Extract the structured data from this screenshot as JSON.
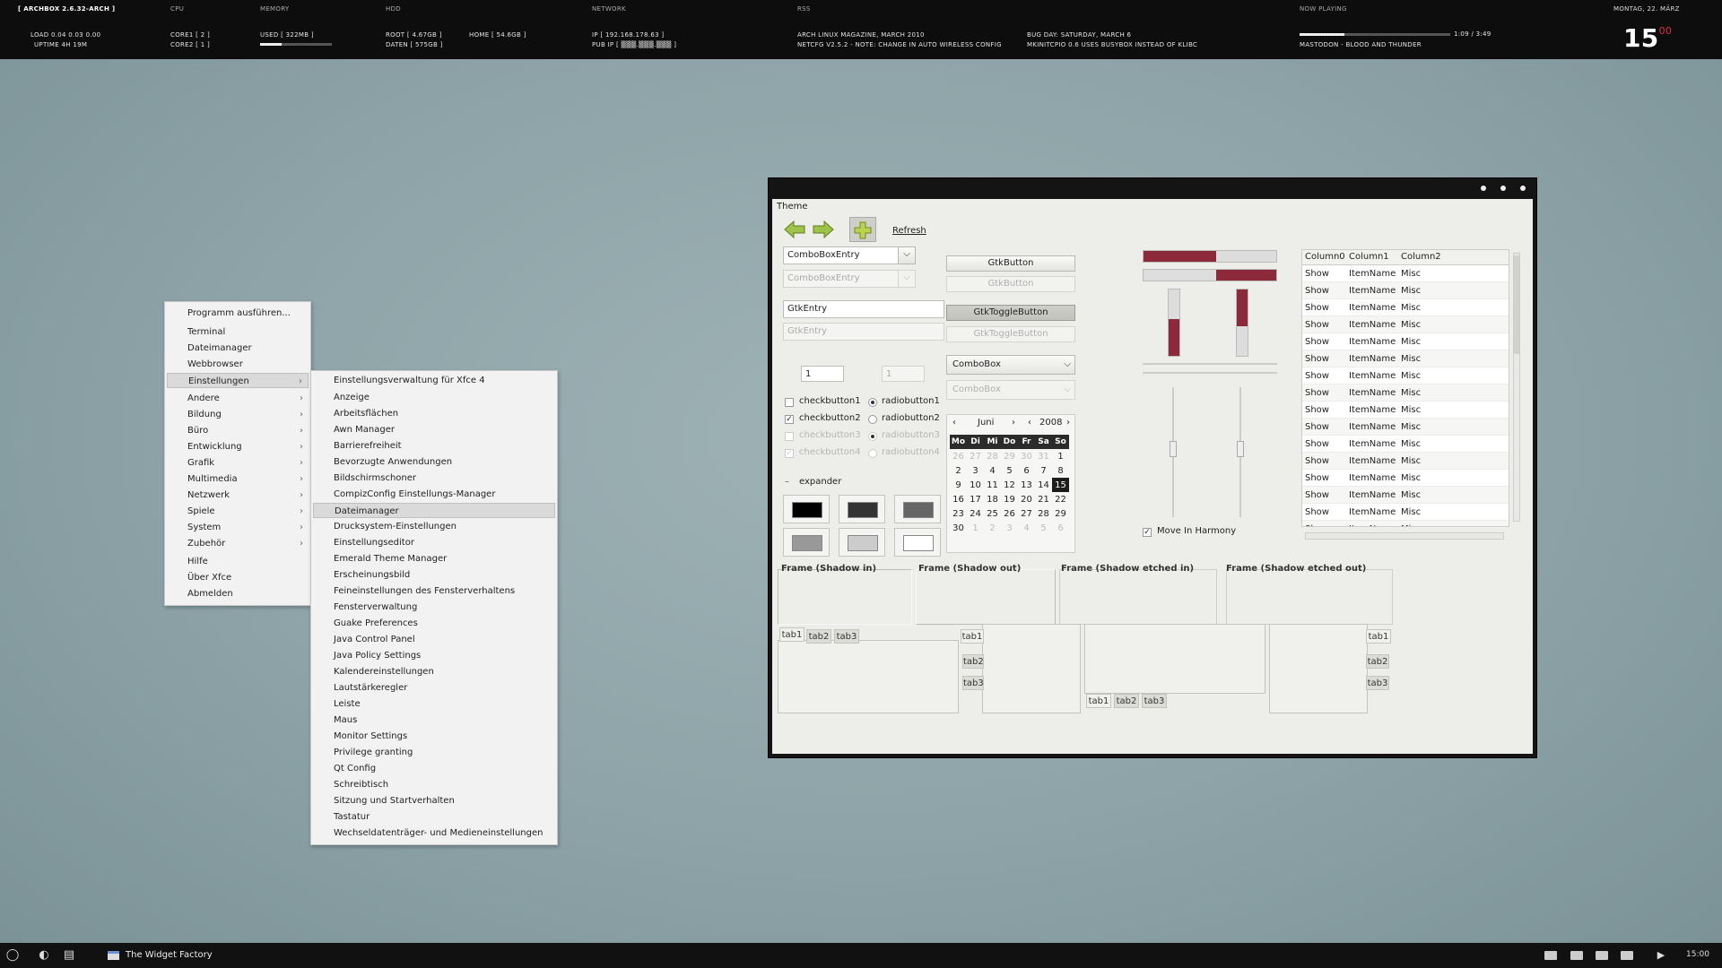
{
  "conky": {
    "distro": "[ ARCHBOX  2.6.32-ARCH ]",
    "load": "LOAD  0.04 0.03 0.00",
    "uptime": "UPTIME    4H 19M",
    "cpu_header": "CPU",
    "core1": "CORE1  [ 2 ]",
    "core2": "CORE2  [ 1 ]",
    "mem_header": "MEMORY",
    "mem_used": "USED  [ 322MB ]",
    "mem_fraction": 0.3,
    "hdd_header": "HDD",
    "hdd_root": "ROOT  [ 4.67GB ]",
    "hdd_daten": "DATEN  [ 575GB ]",
    "hdd_home": "HOME  [ 54.6GB ]",
    "net_header": "NETWORK",
    "ip": "IP      [ 192.168.178.63 ]",
    "pub_ip": "PUB IP  [ ▒▒▒.▒▒▒.▒▒▒ ]",
    "rss_header": "RSS",
    "rss1": "ARCH LINUX MAGAZINE, MARCH 2010",
    "rss2": "NETCFG V2.5.2 - NOTE: CHANGE IN AUTO WIRELESS CONFIG",
    "rss3": "BUG DAY: SATURDAY, MARCH 6",
    "rss4": "MKINITCPIO 0.6 USES BUSYBOX INSTEAD OF KLIBC",
    "np_header": "NOW PLAYING",
    "np_time": "1:09 / 3:49",
    "np_track": "MASTODON - BLOOD AND THUNDER",
    "np_fraction": 0.3,
    "date": "MONTAG, 22. MÄRZ",
    "clock_hour": "15",
    "clock_min": "00"
  },
  "taskbar": {
    "task": "The Widget Factory",
    "clock": "15:00"
  },
  "main_menu": [
    "Programm ausführen...",
    "Terminal",
    "Dateimanager",
    "Webbrowser",
    "Einstellungen",
    "Andere",
    "Bildung",
    "Büro",
    "Entwicklung",
    "Grafik",
    "Multimedia",
    "Netzwerk",
    "Spiele",
    "System",
    "Zubehör",
    "Hilfe",
    "Über Xfce",
    "Abmelden"
  ],
  "sub_menu": [
    "Einstellungsverwaltung für Xfce 4",
    "Anzeige",
    "Arbeitsflächen",
    "Awn Manager",
    "Barrierefreiheit",
    "Bevorzugte Anwendungen",
    "Bildschirmschoner",
    "CompizConfig Einstellungs-Manager",
    "Dateimanager",
    "Drucksystem-Einstellungen",
    "Einstellungseditor",
    "Emerald Theme Manager",
    "Erscheinungsbild",
    "Feineinstellungen des Fensterverhaltens",
    "Fensterverwaltung",
    "Guake Preferences",
    "Java Control Panel",
    "Java Policy Settings",
    "Kalendereinstellungen",
    "Lautstärkeregler",
    "Leiste",
    "Maus",
    "Monitor Settings",
    "Privilege granting",
    "Qt Config",
    "Schreibtisch",
    "Sitzung und Startverhalten",
    "Tastatur",
    "Wechseldatenträger- und Medieneinstellungen"
  ],
  "widget": {
    "menu_title": "Theme",
    "refresh": "Refresh",
    "combo_entry": "ComboBoxEntry",
    "gtk_entry": "GtkEntry",
    "spin": "1",
    "checks": [
      "checkbutton1",
      "checkbutton2",
      "checkbutton3",
      "checkbutton4"
    ],
    "radios": [
      "radiobutton1",
      "radiobutton2",
      "radiobutton3",
      "radiobutton4"
    ],
    "expander": "expander",
    "gtk_button": "GtkButton",
    "gtk_toggle": "GtkToggleButton",
    "combo": "ComboBox",
    "cal_month": "Juni",
    "cal_year": "2008",
    "cal_days": [
      "Mo",
      "Di",
      "Mi",
      "Do",
      "Fr",
      "Sa",
      "So"
    ],
    "cal_rows": [
      [
        "26",
        "27",
        "28",
        "29",
        "30",
        "31",
        "1"
      ],
      [
        "2",
        "3",
        "4",
        "5",
        "6",
        "7",
        "8"
      ],
      [
        "9",
        "10",
        "11",
        "12",
        "13",
        "14",
        "15"
      ],
      [
        "16",
        "17",
        "18",
        "19",
        "20",
        "21",
        "22"
      ],
      [
        "23",
        "24",
        "25",
        "26",
        "27",
        "28",
        "29"
      ],
      [
        "30",
        "1",
        "2",
        "3",
        "4",
        "5",
        "6"
      ]
    ],
    "cal_selected": "15",
    "harmony": "Move In Harmony",
    "tree_cols": [
      "Column0",
      "Column1",
      "Column2"
    ],
    "tree_row": [
      "Show",
      "ItemName",
      "Misc"
    ],
    "frames": [
      "Frame (Shadow in)",
      "Frame (Shadow out)",
      "Frame (Shadow etched in)",
      "Frame (Shadow etched out)"
    ],
    "tabs": [
      "tab1",
      "tab2",
      "tab3"
    ],
    "scales": {
      "h1": 0.55,
      "h2": 0.45,
      "v1": 0.55,
      "v2": 0.55
    },
    "accent": "#8c2a3c"
  }
}
